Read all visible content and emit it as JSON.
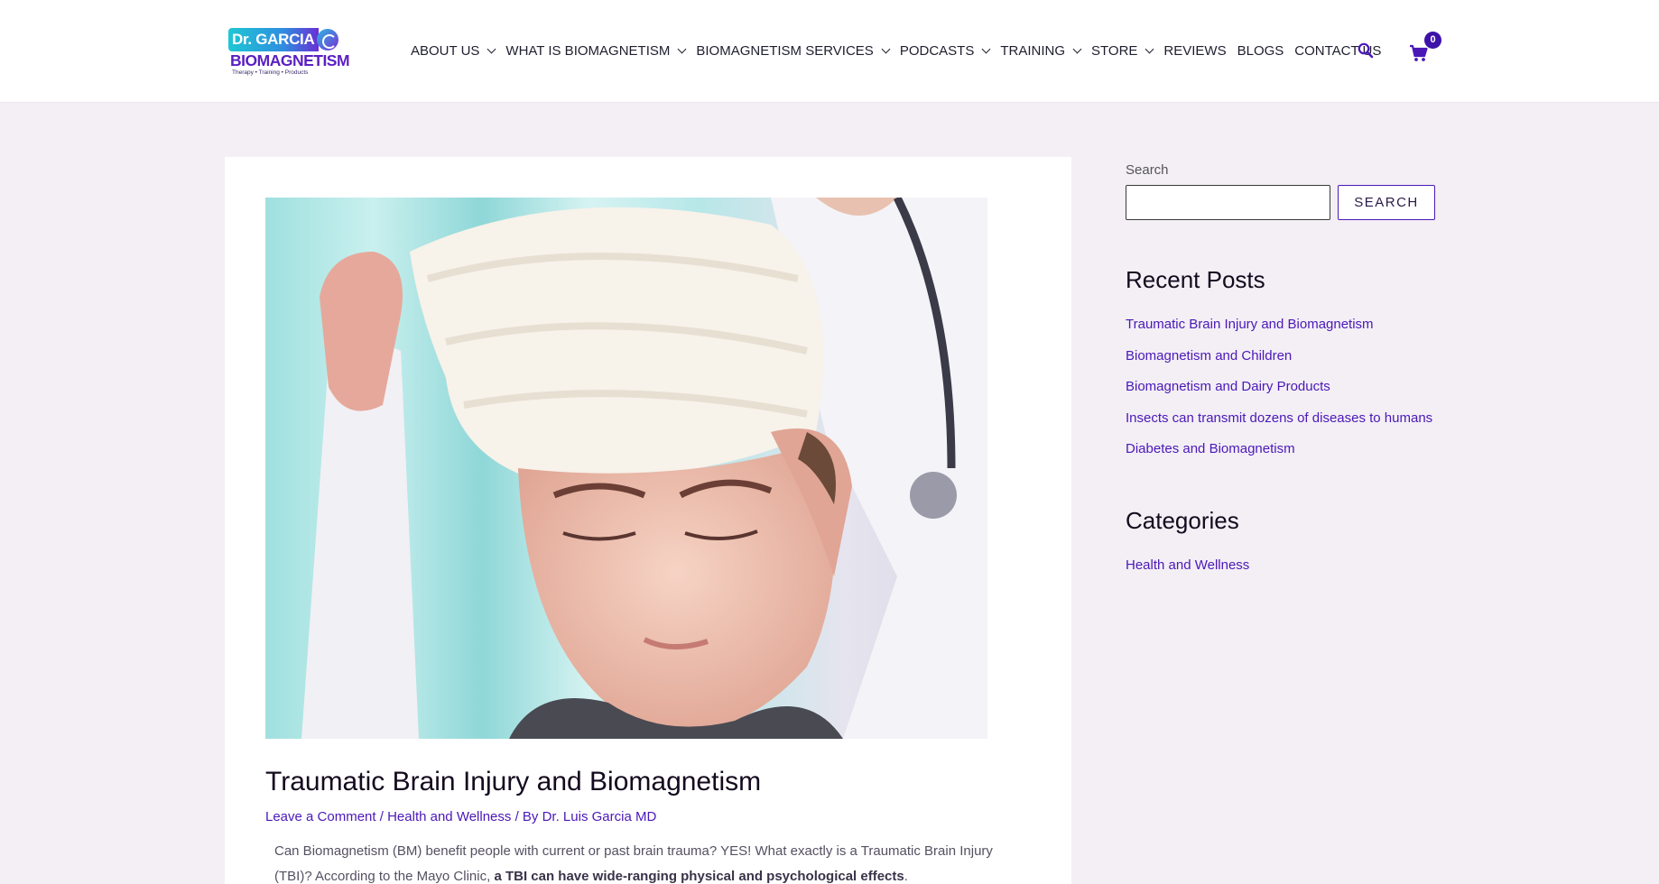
{
  "brand": {
    "logo_dr": "Dr. GARCIA",
    "logo_name": "BIOMAGNETISM",
    "logo_tagline": "Therapy • Training • Products",
    "accent": "#4b18b8",
    "teal": "#1fc7d4"
  },
  "nav": {
    "items": [
      {
        "label": "ABOUT US",
        "dropdown": true
      },
      {
        "label": "WHAT IS BIOMAGNETISM",
        "dropdown": true
      },
      {
        "label": "BIOMAGNETISM SERVICES",
        "dropdown": true
      },
      {
        "label": "PODCASTS",
        "dropdown": true
      },
      {
        "label": "TRAINING",
        "dropdown": true
      },
      {
        "label": "STORE",
        "dropdown": true
      },
      {
        "label": "REVIEWS",
        "dropdown": false
      },
      {
        "label": "BLOGS",
        "dropdown": false
      },
      {
        "label": "CONTACT US",
        "dropdown": false
      }
    ],
    "search_icon": "search-icon",
    "cart_icon": "cart-icon",
    "cart_count": "0"
  },
  "post": {
    "title": "Traumatic Brain Injury and Biomagnetism",
    "meta": {
      "comment_link": "Leave a Comment",
      "sep1": " / ",
      "category": "Health and Wellness",
      "sep2": " / By ",
      "author": "Dr. Luis Garcia MD"
    },
    "excerpt_plain": "Can Biomagnetism (BM) benefit people with current or past brain trauma?  YES!  What exactly is a Traumatic Brain Injury (TBI)?  According to the Mayo Clinic, ",
    "excerpt_bold": "a TBI can have wide-ranging physical and psychological effects",
    "excerpt_end": "."
  },
  "sidebar": {
    "search_label": "Search",
    "search_value": "",
    "search_button": "SEARCH",
    "recent_title": "Recent Posts",
    "recent_posts": [
      "Traumatic Brain Injury and Biomagnetism",
      "Biomagnetism and Children",
      "Biomagnetism and Dairy Products",
      "Insects can transmit dozens of diseases to humans",
      "Diabetes and Biomagnetism"
    ],
    "categories_title": "Categories",
    "categories": [
      "Health and Wellness"
    ]
  }
}
